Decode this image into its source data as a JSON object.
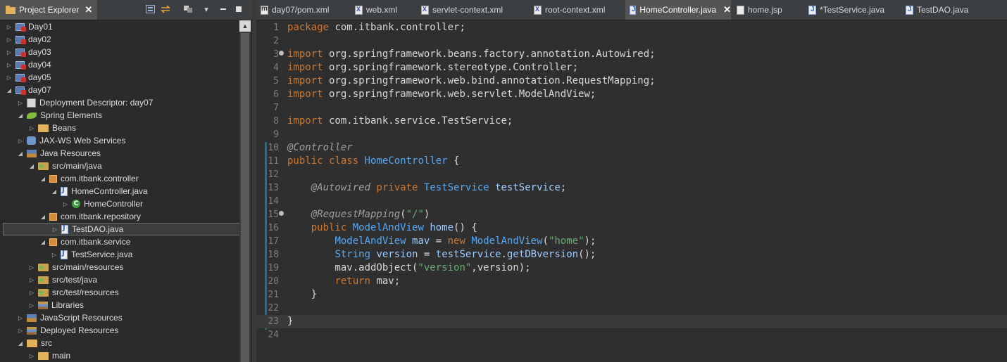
{
  "explorer": {
    "title": "Project Explorer",
    "tree": [
      {
        "label": "Day01",
        "icon": "project-icon",
        "indent": 0,
        "twisty": "collapsed"
      },
      {
        "label": "day02",
        "icon": "project-icon",
        "indent": 0,
        "twisty": "collapsed"
      },
      {
        "label": "day03",
        "icon": "project-icon",
        "indent": 0,
        "twisty": "collapsed"
      },
      {
        "label": "day04",
        "icon": "project-icon",
        "indent": 0,
        "twisty": "collapsed"
      },
      {
        "label": "day05",
        "icon": "project-icon",
        "indent": 0,
        "twisty": "collapsed"
      },
      {
        "label": "day07",
        "icon": "project-icon",
        "indent": 0,
        "twisty": "expanded"
      },
      {
        "label": "Deployment Descriptor: day07",
        "icon": "deployment-descriptor-icon",
        "indent": 1,
        "twisty": "collapsed"
      },
      {
        "label": "Spring Elements",
        "icon": "spring-leaf-icon",
        "indent": 1,
        "twisty": "expanded"
      },
      {
        "label": "Beans",
        "icon": "folder-icon",
        "indent": 2,
        "twisty": "collapsed"
      },
      {
        "label": "JAX-WS Web Services",
        "icon": "web-services-icon",
        "indent": 1,
        "twisty": "collapsed"
      },
      {
        "label": "Java Resources",
        "icon": "java-resources-icon",
        "indent": 1,
        "twisty": "expanded"
      },
      {
        "label": "src/main/java",
        "icon": "source-folder-icon",
        "indent": 2,
        "twisty": "expanded"
      },
      {
        "label": "com.itbank.controller",
        "icon": "package-icon",
        "indent": 3,
        "twisty": "expanded"
      },
      {
        "label": "HomeController.java",
        "icon": "java-file-icon",
        "indent": 4,
        "twisty": "expanded"
      },
      {
        "label": "HomeController",
        "icon": "class-icon",
        "indent": 5,
        "twisty": "collapsed"
      },
      {
        "label": "com.itbank.repository",
        "icon": "package-icon",
        "indent": 3,
        "twisty": "expanded"
      },
      {
        "label": "TestDAO.java",
        "icon": "java-file-icon",
        "indent": 4,
        "twisty": "collapsed",
        "selected": true
      },
      {
        "label": "com.itbank.service",
        "icon": "package-icon",
        "indent": 3,
        "twisty": "expanded"
      },
      {
        "label": "TestService.java",
        "icon": "java-file-icon",
        "indent": 4,
        "twisty": "collapsed"
      },
      {
        "label": "src/main/resources",
        "icon": "source-folder-icon",
        "indent": 2,
        "twisty": "collapsed"
      },
      {
        "label": "src/test/java",
        "icon": "source-folder-icon",
        "indent": 2,
        "twisty": "collapsed"
      },
      {
        "label": "src/test/resources",
        "icon": "source-folder-icon",
        "indent": 2,
        "twisty": "collapsed"
      },
      {
        "label": "Libraries",
        "icon": "libraries-icon",
        "indent": 2,
        "twisty": "collapsed"
      },
      {
        "label": "JavaScript Resources",
        "icon": "javascript-resources-icon",
        "indent": 1,
        "twisty": "collapsed"
      },
      {
        "label": "Deployed Resources",
        "icon": "deployed-resources-icon",
        "indent": 1,
        "twisty": "collapsed"
      },
      {
        "label": "src",
        "icon": "folder-icon",
        "indent": 1,
        "twisty": "expanded"
      },
      {
        "label": "main",
        "icon": "folder-icon",
        "indent": 2,
        "twisty": "collapsed"
      }
    ]
  },
  "editor": {
    "tabs": [
      {
        "label": "day07/pom.xml",
        "icon": "pom-file-icon"
      },
      {
        "label": "web.xml",
        "icon": "xml-file-icon"
      },
      {
        "label": "servlet-context.xml",
        "icon": "xml-file-icon"
      },
      {
        "label": "root-context.xml",
        "icon": "xml-file-icon"
      },
      {
        "label": "HomeController.java",
        "icon": "java-file-icon",
        "active": true
      },
      {
        "label": "home.jsp",
        "icon": "jsp-file-icon"
      },
      {
        "label": "*TestService.java",
        "icon": "java-file-icon"
      },
      {
        "label": "TestDAO.java",
        "icon": "java-file-icon"
      }
    ],
    "current_line": 23,
    "lines": [
      {
        "n": "1",
        "tokens": [
          [
            "kw",
            "package"
          ],
          [
            "plain",
            " com.itbank.controller;"
          ]
        ]
      },
      {
        "n": "2",
        "tokens": []
      },
      {
        "n": "3",
        "fold": true,
        "tokens": [
          [
            "kw",
            "import"
          ],
          [
            "plain",
            " org.springframework.beans.factory.annotation.Autowired;"
          ]
        ]
      },
      {
        "n": "4",
        "tokens": [
          [
            "kw",
            "import"
          ],
          [
            "plain",
            " org.springframework.stereotype.Controller;"
          ]
        ]
      },
      {
        "n": "5",
        "tokens": [
          [
            "kw",
            "import"
          ],
          [
            "plain",
            " org.springframework.web.bind.annotation.RequestMapping;"
          ]
        ]
      },
      {
        "n": "6",
        "tokens": [
          [
            "kw",
            "import"
          ],
          [
            "plain",
            " org.springframework.web.servlet.ModelAndView;"
          ]
        ]
      },
      {
        "n": "7",
        "tokens": []
      },
      {
        "n": "8",
        "tokens": [
          [
            "kw",
            "import"
          ],
          [
            "plain",
            " com.itbank.service.TestService;"
          ]
        ]
      },
      {
        "n": "9",
        "tokens": []
      },
      {
        "n": "10",
        "tokens": [
          [
            "ann",
            "@Controller"
          ]
        ]
      },
      {
        "n": "11",
        "tokens": [
          [
            "kw",
            "public"
          ],
          [
            "plain",
            " "
          ],
          [
            "kw",
            "class"
          ],
          [
            "plain",
            " "
          ],
          [
            "typ",
            "HomeController"
          ],
          [
            "plain",
            " {"
          ]
        ]
      },
      {
        "n": "12",
        "tokens": []
      },
      {
        "n": "13",
        "tokens": [
          [
            "plain",
            "    "
          ],
          [
            "ann",
            "@Autowired"
          ],
          [
            "plain",
            " "
          ],
          [
            "kw",
            "private"
          ],
          [
            "plain",
            " "
          ],
          [
            "typ",
            "TestService"
          ],
          [
            "plain",
            " "
          ],
          [
            "fld",
            "testService"
          ],
          [
            "plain",
            ";"
          ]
        ]
      },
      {
        "n": "14",
        "tokens": []
      },
      {
        "n": "15",
        "fold": true,
        "tokens": [
          [
            "plain",
            "    "
          ],
          [
            "ann",
            "@RequestMapping"
          ],
          [
            "plain",
            "("
          ],
          [
            "str",
            "\"/\""
          ],
          [
            "plain",
            ")"
          ]
        ]
      },
      {
        "n": "16",
        "tokens": [
          [
            "plain",
            "    "
          ],
          [
            "kw",
            "public"
          ],
          [
            "plain",
            " "
          ],
          [
            "typ",
            "ModelAndView"
          ],
          [
            "plain",
            " "
          ],
          [
            "fld",
            "home"
          ],
          [
            "plain",
            "() {"
          ]
        ]
      },
      {
        "n": "17",
        "tokens": [
          [
            "plain",
            "        "
          ],
          [
            "typ",
            "ModelAndView"
          ],
          [
            "plain",
            " "
          ],
          [
            "fld",
            "mav"
          ],
          [
            "plain",
            " = "
          ],
          [
            "kw",
            "new"
          ],
          [
            "plain",
            " "
          ],
          [
            "typ",
            "ModelAndView"
          ],
          [
            "plain",
            "("
          ],
          [
            "str",
            "\"home\""
          ],
          [
            "plain",
            ");"
          ]
        ]
      },
      {
        "n": "18",
        "tokens": [
          [
            "plain",
            "        "
          ],
          [
            "typ",
            "String"
          ],
          [
            "plain",
            " "
          ],
          [
            "fld",
            "version"
          ],
          [
            "plain",
            " = "
          ],
          [
            "fld",
            "testService"
          ],
          [
            "plain",
            "."
          ],
          [
            "fld",
            "getDBversion"
          ],
          [
            "plain",
            "();"
          ]
        ]
      },
      {
        "n": "19",
        "tokens": [
          [
            "plain",
            "        mav.addObject("
          ],
          [
            "str",
            "\"version\""
          ],
          [
            "plain",
            ",version);"
          ]
        ]
      },
      {
        "n": "20",
        "tokens": [
          [
            "plain",
            "        "
          ],
          [
            "kw",
            "return"
          ],
          [
            "plain",
            " mav;"
          ]
        ]
      },
      {
        "n": "21",
        "tokens": [
          [
            "plain",
            "    }"
          ]
        ]
      },
      {
        "n": "22",
        "tokens": []
      },
      {
        "n": "23",
        "tokens": [
          [
            "plain",
            "}"
          ]
        ]
      },
      {
        "n": "24",
        "tokens": []
      }
    ]
  }
}
